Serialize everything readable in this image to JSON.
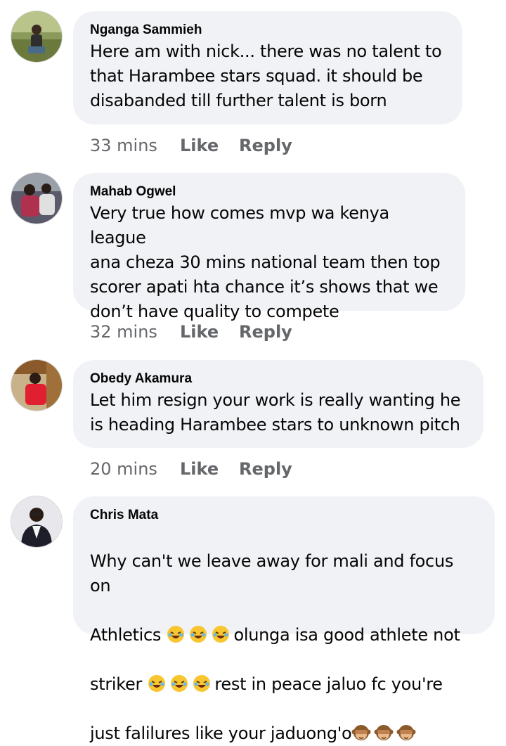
{
  "comments": [
    {
      "author": "Nganga Sammieh",
      "text": "Here  am with nick... there was no talent to\nthat Harambee stars squad. it should be\ndisabanded till further talent is born",
      "time": "33 mins",
      "like_label": "Like",
      "reply_label": "Reply"
    },
    {
      "author": "Mahab Ogwel",
      "text": "Very true how comes mvp wa kenya league\nana cheza 30 mins national team then top\nscorer apati hta chance it’s shows that we\ndon’t have quality to compete",
      "time": "32 mins",
      "like_label": "Like",
      "reply_label": "Reply"
    },
    {
      "author": "Obedy Akamura",
      "text": "Let him resign your work is really wanting  he\nis heading Harambee stars to unknown pitch",
      "time": "20 mins",
      "like_label": "Like",
      "reply_label": "Reply"
    },
    {
      "author": "Chris Mata",
      "line1": "Why can't we leave away for mali and focus on",
      "line2_a": "Athletics ",
      "line2_b": "olunga isa good athlete not",
      "line3_a": "striker ",
      "line3_b": "rest in peace jaluo fc you're",
      "line4_a": "just falilures like your jaduong'o",
      "emojis": [
        "rolling-on-floor-laughing",
        "see-no-evil-monkey"
      ]
    }
  ],
  "colors": {
    "bubble": "#f0f2f5",
    "text": "#050505",
    "secondary": "#65676b"
  }
}
